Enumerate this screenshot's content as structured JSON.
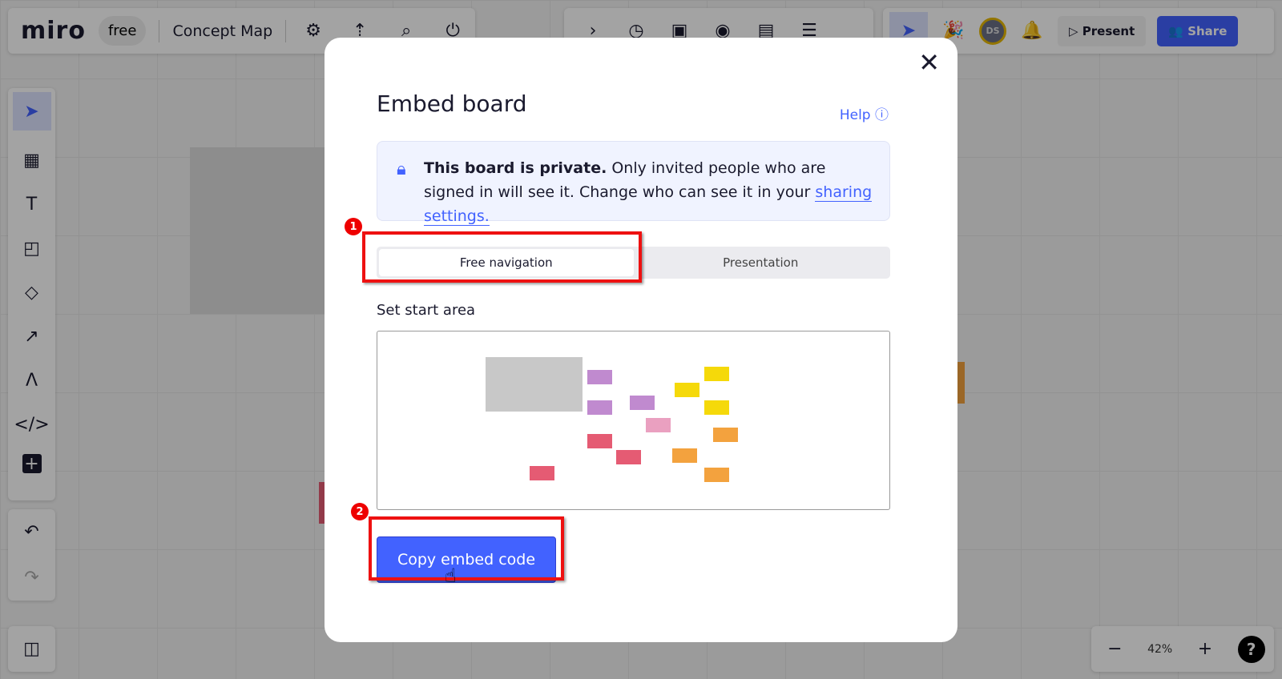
{
  "header": {
    "logo": "miro",
    "plan": "free",
    "board_title": "Concept Map",
    "left_icons": [
      "gear-icon",
      "upload-icon",
      "search-icon",
      "plug-icon"
    ],
    "center_icons": [
      "chevron-right-icon",
      "timer-icon",
      "frame-icon",
      "focus-icon",
      "counter-icon",
      "notes-icon",
      "chevron-double-down-icon"
    ],
    "avatar_initials": "DS",
    "present_label": "Present",
    "share_label": "Share",
    "accent": "#4262ff"
  },
  "toolbar": {
    "tools": [
      "select",
      "templates",
      "text",
      "sticky-note",
      "shapes",
      "line",
      "pen",
      "embed",
      "add"
    ]
  },
  "zoom": {
    "level": "42%",
    "help": "?"
  },
  "modal": {
    "title": "Embed board",
    "help_label": "Help",
    "notice": {
      "bold": "This board is private.",
      "text": " Only invited people who are signed in will see it. Change who can see it in your ",
      "link": "sharing settings."
    },
    "tabs": [
      {
        "label": "Free navigation",
        "selected": true
      },
      {
        "label": "Presentation",
        "selected": false
      }
    ],
    "start_area_label": "Set start area",
    "copy_button": "Copy embed code",
    "annotations": [
      "1",
      "2"
    ]
  }
}
